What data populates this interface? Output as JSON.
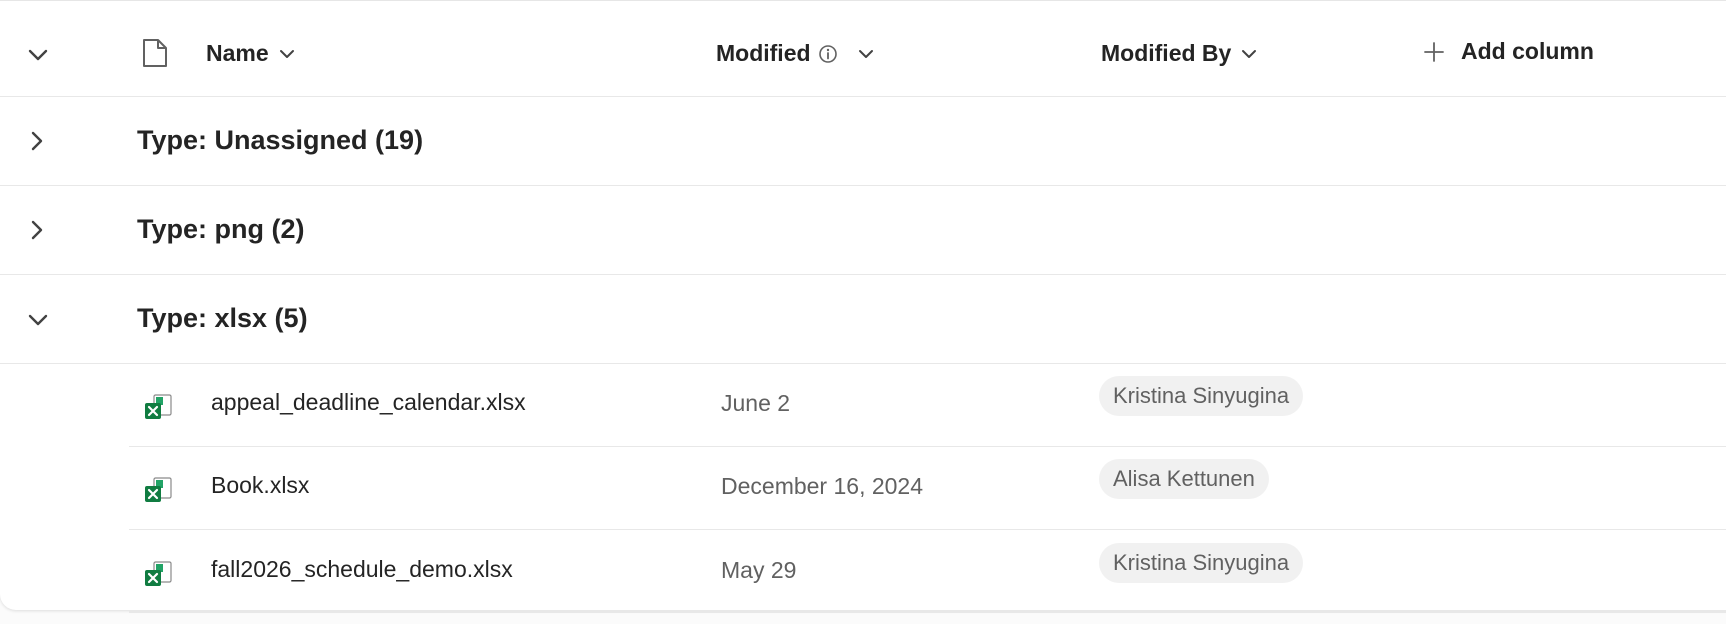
{
  "columns": {
    "name": "Name",
    "modified": "Modified",
    "modified_by": "Modified By",
    "add_column": "Add column"
  },
  "groups": [
    {
      "title": "Type: Unassigned (19)",
      "expanded": false
    },
    {
      "title": "Type: png (2)",
      "expanded": false
    },
    {
      "title": "Type: xlsx (5)",
      "expanded": true
    }
  ],
  "files": [
    {
      "name": "appeal_deadline_calendar.xlsx",
      "modified": "June 2",
      "modified_by": "Kristina Sinyugina",
      "icon": "excel-file-icon"
    },
    {
      "name": "Book.xlsx",
      "modified": "December 16, 2024",
      "modified_by": "Alisa Kettunen",
      "icon": "excel-file-icon"
    },
    {
      "name": "fall2026_schedule_demo.xlsx",
      "modified": "May 29",
      "modified_by": "Kristina Sinyugina",
      "icon": "excel-file-icon"
    }
  ],
  "colors": {
    "excel_green": "#107c41",
    "excel_light": "#21a366",
    "pill_bg": "#f1f1f1",
    "text_secondary": "#616161"
  }
}
